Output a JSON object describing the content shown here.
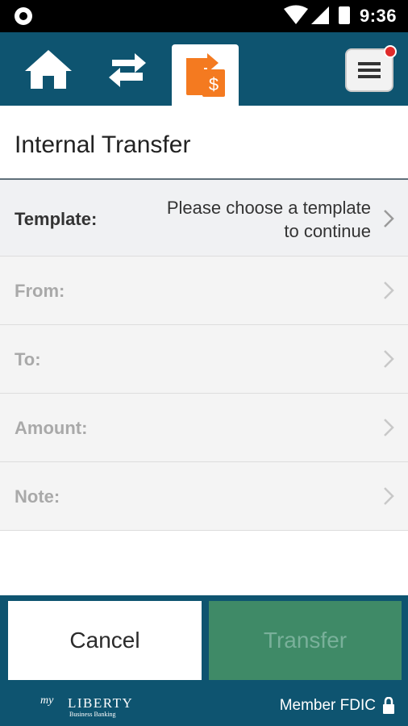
{
  "status_bar": {
    "time": "9:36",
    "icons": [
      "circle-notification-icon",
      "wifi-icon",
      "signal-icon",
      "battery-icon"
    ]
  },
  "nav": {
    "items": [
      {
        "name": "home-icon",
        "active": false
      },
      {
        "name": "transfer-arrows-icon",
        "active": false
      },
      {
        "name": "payment-transfer-icon",
        "active": true
      },
      {
        "name": "menu-icon",
        "active": false,
        "has_notification": true
      }
    ],
    "accent_color": "#f47a20"
  },
  "page": {
    "title": "Internal Transfer"
  },
  "form": {
    "template": {
      "label": "Template:",
      "value_line1": "Please choose a template",
      "value_line2": "to continue"
    },
    "from": {
      "label": "From:"
    },
    "to": {
      "label": "To:"
    },
    "amount": {
      "label": "Amount:"
    },
    "note": {
      "label": "Note:"
    }
  },
  "actions": {
    "cancel_label": "Cancel",
    "transfer_label": "Transfer",
    "transfer_disabled": true
  },
  "footer": {
    "logo_text": "LIBERTY",
    "logo_script": "my",
    "logo_subtext": "Business Banking",
    "fdic_label": "Member FDIC"
  },
  "colors": {
    "primary": "#0e5470",
    "transfer_button": "#3f8a67",
    "notification_badge": "#e02b2b"
  }
}
